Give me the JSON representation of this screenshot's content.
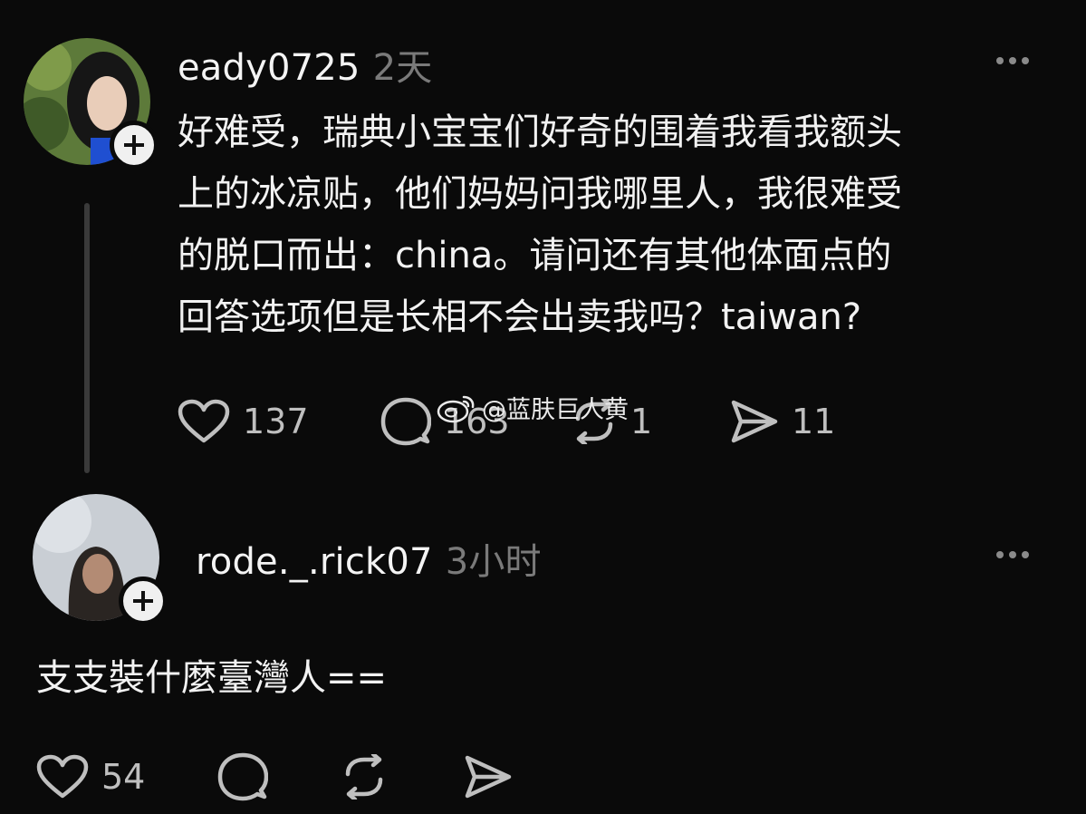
{
  "posts": [
    {
      "username": "eady0725",
      "time": "2天",
      "lines": [
        "好难受，瑞典小宝宝们好奇的围着我看我额头",
        "上的冰凉贴，他们妈妈问我哪里人，我很难受",
        "的脱口而出：china。请问还有其他体面点的",
        "回答选项但是长相不会出卖我吗？taiwan?"
      ],
      "likes": "137",
      "comments": "163",
      "reposts": "1",
      "shares": "11"
    },
    {
      "username": "rode._.rick07",
      "time": "3小时",
      "text": "支支裝什麼臺灣人==",
      "likes": "54"
    }
  ],
  "watermark": "@蓝肤巨人黄",
  "icons": [
    "plus-icon",
    "more-icon",
    "heart-icon",
    "comment-icon",
    "repost-icon",
    "send-icon",
    "weibo-icon"
  ],
  "colors": {
    "background": "#0a0a0a",
    "text": "#f2f2f2",
    "muted": "#7a7a7a",
    "icon": "#bfbfbf"
  }
}
